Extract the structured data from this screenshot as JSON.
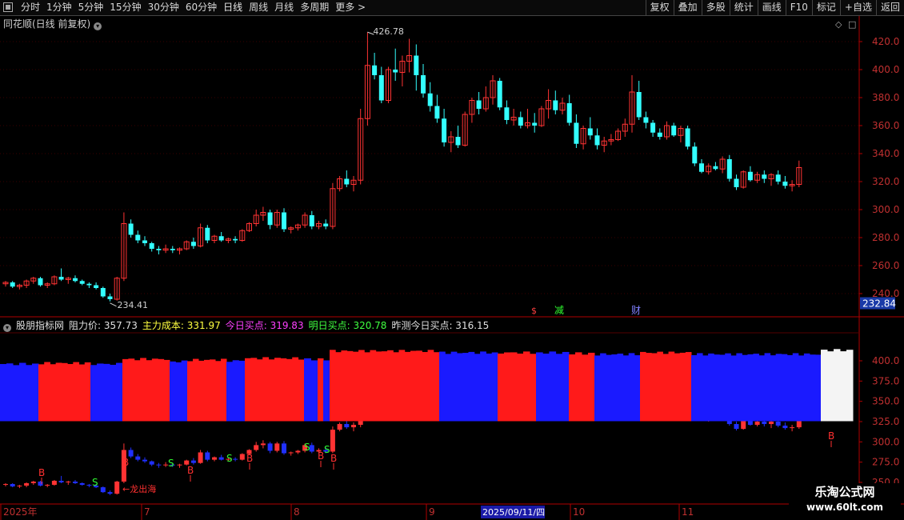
{
  "toolbar": {
    "tabs": [
      "分时",
      "1分钟",
      "5分钟",
      "15分钟",
      "30分钟",
      "60分钟",
      "日线",
      "周线",
      "月线",
      "多周期",
      "更多 >"
    ],
    "active_tab": "日线",
    "right_buttons": [
      "复权",
      "叠加",
      "多股",
      "统计",
      "画线",
      "F10",
      "标记",
      "+自选",
      "返回"
    ]
  },
  "main_chart": {
    "title": "同花顺(日线 前复权)",
    "high_label": "426.78",
    "low_label": "234.41",
    "current_price": "232.84",
    "markers": [
      "$",
      "减",
      "财"
    ],
    "y_ticks": [
      "420.0",
      "400.0",
      "380.0",
      "360.0",
      "340.0",
      "320.0",
      "300.0",
      "280.0",
      "260.0",
      "240.0"
    ]
  },
  "indicator": {
    "name": "股朋指标网",
    "fields": [
      {
        "label": "阻力价: ",
        "value": "357.73",
        "color": "#e0e0e0"
      },
      {
        "label": "主力成本: ",
        "value": "331.97",
        "color": "#ffff40"
      },
      {
        "label": "今日买点: ",
        "value": "319.83",
        "color": "#ff40ff"
      },
      {
        "label": "明日买点: ",
        "value": "320.78",
        "color": "#40ff40"
      },
      {
        "label": "昨测今日买点: ",
        "value": "316.15",
        "color": "#e0e0e0"
      }
    ],
    "y_ticks": [
      "400.0",
      "375.0",
      "350.0",
      "325.0",
      "300.0",
      "275.0",
      "250.0"
    ],
    "annotation": "龙出海"
  },
  "x_axis": {
    "labels": [
      "2025年",
      "7",
      "8",
      "9",
      "10",
      "11"
    ],
    "highlight_date": "2025/09/11/四"
  },
  "watermark": {
    "line1": "乐淘公式网",
    "line2": "www.60lt.com"
  },
  "colors": {
    "up": "#ff3333",
    "down": "#33ffff",
    "blue_band": "#1a1aff",
    "red_band": "#ff1a1a",
    "white_band": "#f4f4f4",
    "axis": "#b00000"
  },
  "chart_data": {
    "type": "candlestick",
    "candles": [
      [
        247,
        249,
        245,
        248
      ],
      [
        248,
        249,
        244,
        245
      ],
      [
        245,
        247,
        243,
        246
      ],
      [
        246,
        250,
        244,
        249
      ],
      [
        249,
        252,
        247,
        251
      ],
      [
        251,
        252,
        245,
        246
      ],
      [
        246,
        248,
        244,
        247
      ],
      [
        247,
        253,
        246,
        252
      ],
      [
        252,
        258,
        249,
        250
      ],
      [
        250,
        252,
        247,
        251
      ],
      [
        251,
        253,
        248,
        249
      ],
      [
        249,
        250,
        246,
        247
      ],
      [
        247,
        248,
        244,
        246
      ],
      [
        246,
        248,
        243,
        244
      ],
      [
        244,
        245,
        237,
        238
      ],
      [
        238,
        240,
        234.41,
        236
      ],
      [
        236,
        252,
        235,
        251
      ],
      [
        251,
        298,
        249,
        290
      ],
      [
        290,
        293,
        280,
        282
      ],
      [
        282,
        285,
        276,
        278
      ],
      [
        278,
        281,
        274,
        276
      ],
      [
        276,
        277,
        270,
        272
      ],
      [
        272,
        274,
        268,
        271
      ],
      [
        271,
        275,
        269,
        272
      ],
      [
        272,
        274,
        269,
        271
      ],
      [
        271,
        273,
        268,
        272
      ],
      [
        272,
        278,
        271,
        277
      ],
      [
        277,
        280,
        272,
        274
      ],
      [
        274,
        290,
        273,
        287
      ],
      [
        287,
        289,
        276,
        278
      ],
      [
        278,
        282,
        276,
        281
      ],
      [
        281,
        284,
        277,
        278
      ],
      [
        278,
        280,
        276,
        279
      ],
      [
        279,
        281,
        276,
        278
      ],
      [
        278,
        286,
        277,
        285
      ],
      [
        285,
        291,
        284,
        290
      ],
      [
        290,
        300,
        288,
        296
      ],
      [
        296,
        302,
        292,
        298
      ],
      [
        298,
        300,
        286,
        289
      ],
      [
        289,
        300,
        287,
        298
      ],
      [
        298,
        301,
        284,
        286
      ],
      [
        286,
        288,
        283,
        287
      ],
      [
        287,
        290,
        285,
        289
      ],
      [
        289,
        298,
        287,
        296
      ],
      [
        296,
        299,
        286,
        288
      ],
      [
        288,
        292,
        286,
        290
      ],
      [
        290,
        293,
        286,
        288
      ],
      [
        288,
        319,
        286,
        315
      ],
      [
        315,
        324,
        313,
        322
      ],
      [
        322,
        328,
        316,
        318
      ],
      [
        318,
        324,
        313,
        321
      ],
      [
        321,
        372,
        318,
        365
      ],
      [
        365,
        426.78,
        360,
        403
      ],
      [
        403,
        412,
        393,
        396
      ],
      [
        396,
        402,
        376,
        378
      ],
      [
        378,
        402,
        376,
        400
      ],
      [
        400,
        415,
        392,
        398
      ],
      [
        398,
        410,
        388,
        406
      ],
      [
        406,
        422,
        398,
        410
      ],
      [
        410,
        418,
        385,
        396
      ],
      [
        396,
        404,
        380,
        383
      ],
      [
        383,
        391,
        370,
        374
      ],
      [
        374,
        382,
        362,
        365
      ],
      [
        365,
        372,
        345,
        348
      ],
      [
        348,
        356,
        341,
        352
      ],
      [
        352,
        360,
        344,
        346
      ],
      [
        346,
        370,
        345,
        368
      ],
      [
        368,
        380,
        362,
        378
      ],
      [
        378,
        384,
        368,
        372
      ],
      [
        372,
        388,
        370,
        380
      ],
      [
        380,
        396,
        375,
        392
      ],
      [
        392,
        394,
        371,
        373
      ],
      [
        373,
        378,
        361,
        364
      ],
      [
        364,
        372,
        360,
        366
      ],
      [
        366,
        370,
        358,
        360
      ],
      [
        360,
        372,
        358,
        362
      ],
      [
        362,
        369,
        355,
        360
      ],
      [
        360,
        374,
        359,
        372
      ],
      [
        372,
        386,
        365,
        378
      ],
      [
        378,
        385,
        368,
        371
      ],
      [
        371,
        380,
        368,
        376
      ],
      [
        376,
        382,
        360,
        362
      ],
      [
        362,
        368,
        344,
        347
      ],
      [
        347,
        360,
        343,
        358
      ],
      [
        358,
        366,
        350,
        353
      ],
      [
        353,
        358,
        343,
        346
      ],
      [
        346,
        352,
        341,
        349
      ],
      [
        349,
        354,
        346,
        350
      ],
      [
        350,
        358,
        349,
        356
      ],
      [
        356,
        365,
        352,
        361
      ],
      [
        361,
        396,
        355,
        384
      ],
      [
        384,
        392,
        364,
        366
      ],
      [
        366,
        370,
        358,
        362
      ],
      [
        362,
        364,
        352,
        355
      ],
      [
        355,
        358,
        350,
        352
      ],
      [
        352,
        363,
        350,
        360
      ],
      [
        360,
        362,
        352,
        353
      ],
      [
        353,
        360,
        348,
        358
      ],
      [
        358,
        360,
        343,
        345
      ],
      [
        345,
        348,
        331,
        333
      ],
      [
        333,
        336,
        326,
        327
      ],
      [
        327,
        333,
        325,
        331
      ],
      [
        331,
        334,
        328,
        329
      ],
      [
        329,
        338,
        326,
        336
      ],
      [
        336,
        339,
        320,
        322
      ],
      [
        322,
        325,
        314,
        316
      ],
      [
        316,
        328,
        315,
        327
      ],
      [
        327,
        331,
        320,
        321
      ],
      [
        321,
        327,
        319,
        325
      ],
      [
        325,
        328,
        319,
        322
      ],
      [
        322,
        326,
        317,
        325
      ],
      [
        325,
        328,
        318,
        320
      ],
      [
        320,
        324,
        315,
        317
      ],
      [
        317,
        321,
        313,
        318
      ],
      [
        318,
        335,
        316,
        330
      ]
    ]
  }
}
